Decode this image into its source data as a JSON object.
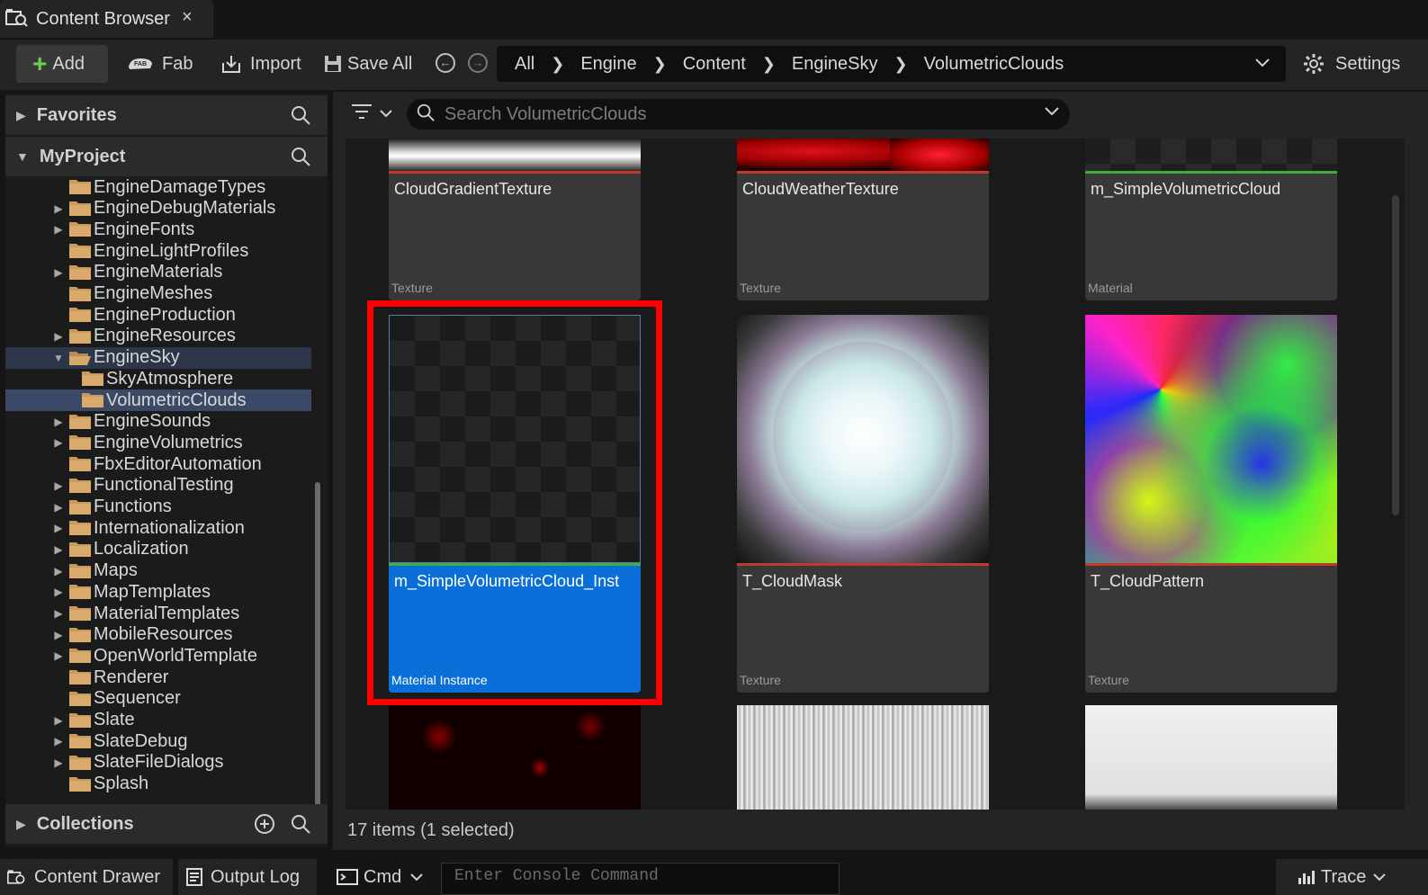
{
  "tab": {
    "title": "Content Browser",
    "close": "×"
  },
  "toolbar": {
    "add": "Add",
    "fab": "Fab",
    "import": "Import",
    "save_all": "Save All",
    "back": "←",
    "forward": "→",
    "breadcrumb": [
      "All",
      "Engine",
      "Content",
      "EngineSky",
      "VolumetricClouds"
    ],
    "settings": "Settings"
  },
  "sidebar": {
    "favorites": "Favorites",
    "project": "MyProject",
    "collections": "Collections",
    "folders": [
      {
        "name": "EngineDamageTypes",
        "expandable": false
      },
      {
        "name": "EngineDebugMaterials",
        "expandable": true
      },
      {
        "name": "EngineFonts",
        "expandable": true
      },
      {
        "name": "EngineLightProfiles",
        "expandable": false
      },
      {
        "name": "EngineMaterials",
        "expandable": true
      },
      {
        "name": "EngineMeshes",
        "expandable": false
      },
      {
        "name": "EngineProduction",
        "expandable": false
      },
      {
        "name": "EngineResources",
        "expandable": true
      },
      {
        "name": "EngineSky",
        "expandable": true,
        "expanded": true
      },
      {
        "name": "SkyAtmosphere",
        "expandable": false,
        "child": true
      },
      {
        "name": "VolumetricClouds",
        "expandable": false,
        "child": true,
        "selected": true
      },
      {
        "name": "EngineSounds",
        "expandable": true
      },
      {
        "name": "EngineVolumetrics",
        "expandable": true
      },
      {
        "name": "FbxEditorAutomation",
        "expandable": false
      },
      {
        "name": "FunctionalTesting",
        "expandable": true
      },
      {
        "name": "Functions",
        "expandable": true
      },
      {
        "name": "Internationalization",
        "expandable": true
      },
      {
        "name": "Localization",
        "expandable": true
      },
      {
        "name": "Maps",
        "expandable": true
      },
      {
        "name": "MapTemplates",
        "expandable": true
      },
      {
        "name": "MaterialTemplates",
        "expandable": true
      },
      {
        "name": "MobileResources",
        "expandable": true
      },
      {
        "name": "OpenWorldTemplate",
        "expandable": true
      },
      {
        "name": "Renderer",
        "expandable": false
      },
      {
        "name": "Sequencer",
        "expandable": false
      },
      {
        "name": "Slate",
        "expandable": true
      },
      {
        "name": "SlateDebug",
        "expandable": true
      },
      {
        "name": "SlateFileDialogs",
        "expandable": true
      },
      {
        "name": "Splash",
        "expandable": false
      }
    ]
  },
  "search": {
    "placeholder": "Search VolumetricClouds"
  },
  "assets": [
    {
      "name": "CloudGradientTexture",
      "type": "Texture",
      "bar_color": "#c0392b"
    },
    {
      "name": "CloudWeatherTexture",
      "type": "Texture",
      "bar_color": "#c0392b"
    },
    {
      "name": "m_SimpleVolumetricCloud",
      "type": "Material",
      "bar_color": "#3fae3f"
    },
    {
      "name": "m_SimpleVolumetricCloud_Inst",
      "type": "Material Instance",
      "bar_color": "#3fae3f",
      "selected": true
    },
    {
      "name": "T_CloudMask",
      "type": "Texture",
      "bar_color": "#c0392b"
    },
    {
      "name": "T_CloudPattern",
      "type": "Texture",
      "bar_color": "#c0392b"
    }
  ],
  "status": "17 items (1 selected)",
  "bottom": {
    "content_drawer": "Content Drawer",
    "output_log": "Output Log",
    "cmd": "Cmd",
    "console_placeholder": "Enter Console Command",
    "trace": "Trace"
  },
  "colors": {
    "accent": "#0a6fd8",
    "highlight": "#ff0000"
  }
}
